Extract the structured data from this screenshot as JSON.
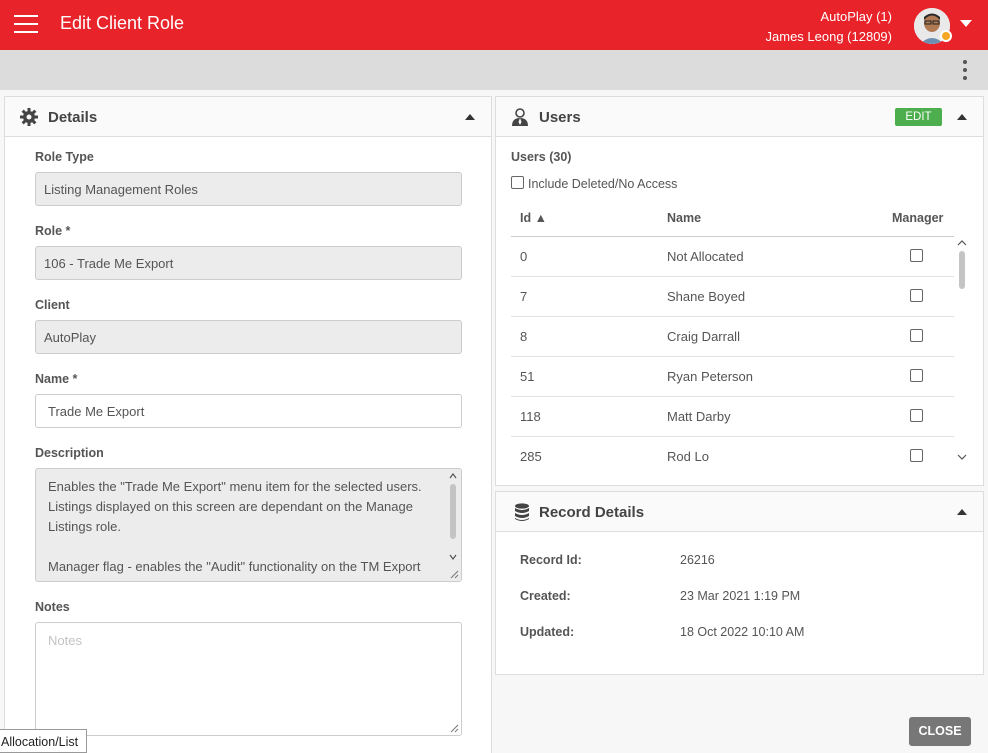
{
  "header": {
    "title": "Edit Client Role",
    "client": "AutoPlay (1)",
    "user": "James Leong (12809)",
    "accent": "#e8232a"
  },
  "details": {
    "title": "Details",
    "role_type_label": "Role Type",
    "role_type_value": "Listing Management Roles",
    "role_label": "Role *",
    "role_value": "106 - Trade Me Export",
    "client_label": "Client",
    "client_value": "AutoPlay",
    "name_label": "Name *",
    "name_value": "Trade Me Export",
    "description_label": "Description",
    "description_line1": "Enables the \"Trade Me Export\" menu item for the selected users.",
    "description_line2": "Listings displayed on this screen are dependant on the Manage",
    "description_line3": "Listings role.",
    "description_line4": "Manager flag - enables the \"Audit\" functionality on the TM Export",
    "notes_label": "Notes",
    "notes_placeholder": "Notes"
  },
  "users": {
    "title": "Users",
    "edit_label": "EDIT",
    "count_label": "Users (30)",
    "include_deleted_label": "Include Deleted/No Access",
    "columns": {
      "id": "Id ▲",
      "name": "Name",
      "manager": "Manager"
    },
    "rows": [
      {
        "id": "0",
        "name": "Not Allocated"
      },
      {
        "id": "7",
        "name": "Shane Boyed"
      },
      {
        "id": "8",
        "name": "Craig Darrall"
      },
      {
        "id": "51",
        "name": "Ryan Peterson"
      },
      {
        "id": "118",
        "name": "Matt Darby"
      },
      {
        "id": "285",
        "name": "Rod Lo"
      }
    ]
  },
  "record": {
    "title": "Record Details",
    "record_id_label": "Record Id:",
    "record_id_value": "26216",
    "created_label": "Created:",
    "created_value": "23 Mar 2021 1:19 PM",
    "updated_label": "Updated:",
    "updated_value": "18 Oct 2022 10:10 AM"
  },
  "footer": {
    "close_label": "CLOSE",
    "tooltip": "Allocation/List"
  }
}
